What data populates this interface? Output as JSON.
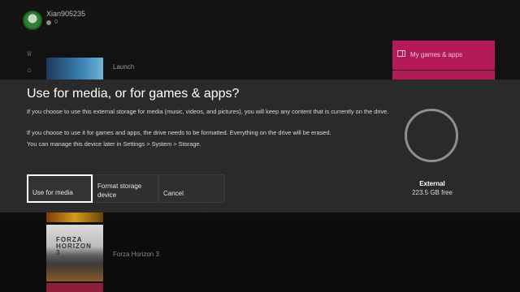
{
  "profile": {
    "gamertag": "Xian905235",
    "gamerscore": "0"
  },
  "home": {
    "launch_label": "Launch",
    "pins_label": "My games & apps",
    "forza_title": "Forza Horizon 3",
    "forza_logo_text": "FORZA HORIZON 3"
  },
  "dialog": {
    "title": "Use for media, or for games & apps?",
    "text1": "If you choose to use this external storage for media (music, videos, and pictures), you will keep any content that is currently on the drive.",
    "text2": "If you choose to use it for games and apps, the drive needs to be formatted. Everything on the drive will be erased.",
    "text3": "You can manage this device later in Settings > System > Storage.",
    "buttons": {
      "media": "Use for media",
      "format": "Format storage device",
      "cancel": "Cancel"
    },
    "drive": {
      "name": "External",
      "free": "223.5 GB free"
    }
  },
  "colors": {
    "accent_pink": "#b4195a",
    "dialog_bg": "#2a2a2a"
  },
  "icons": [
    "avatar",
    "gamerscore-icon",
    "trophy-icon",
    "home-icon",
    "my-games-icon"
  ]
}
